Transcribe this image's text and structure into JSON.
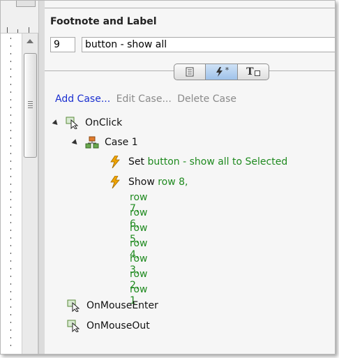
{
  "panel": {
    "title": "Footnote and Label",
    "footnote_number": "9",
    "label_value": "button - show all"
  },
  "toolbar": {
    "tabs": [
      {
        "icon": "page-notes-icon",
        "active": false
      },
      {
        "icon": "interactions-icon",
        "label": "*",
        "active": true
      },
      {
        "icon": "text-style-icon",
        "label": "T",
        "active": false
      }
    ]
  },
  "actions": {
    "add_case": "Add Case...",
    "edit_case": "Edit Case...",
    "delete_case": "Delete Case"
  },
  "tree": {
    "onclick": "OnClick",
    "case1": "Case 1",
    "set_verb": "Set",
    "set_target": "button - show all to Selected",
    "show_verb": "Show",
    "show_targets": [
      "row 8,",
      "row 7,",
      "row 6,",
      "row 5,",
      "row 4,",
      "row 3,",
      "row 2,",
      "row 1"
    ],
    "onmouseenter": "OnMouseEnter",
    "onmouseout": "OnMouseOut"
  },
  "colors": {
    "link": "#1a2fd0",
    "disabled": "#8a8a8a",
    "target_green": "#1f8a1f",
    "lightning": "#f0a400"
  }
}
